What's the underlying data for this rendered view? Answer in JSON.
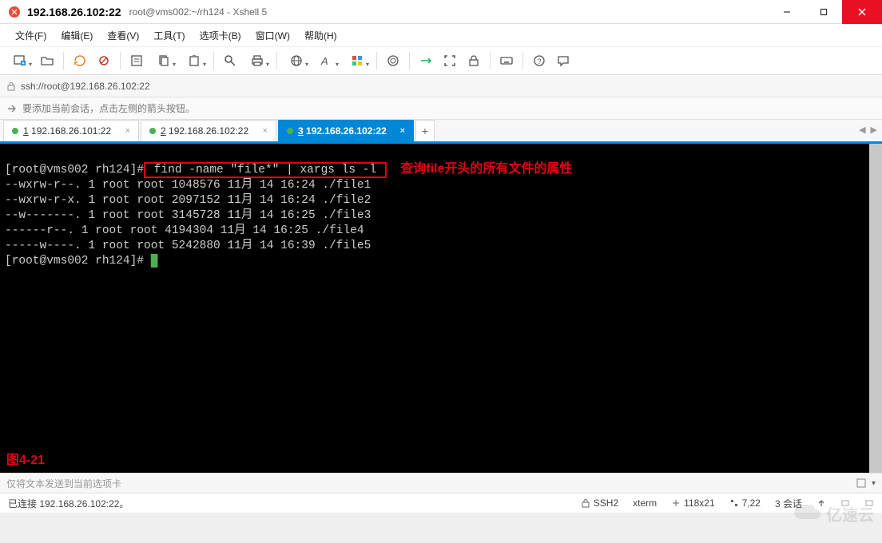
{
  "titlebar": {
    "host": "192.168.26.102:22",
    "subtitle": "root@vms002:~/rh124 - Xshell 5"
  },
  "menu": {
    "file": "文件(F)",
    "edit": "编辑(E)",
    "view": "查看(V)",
    "tools": "工具(T)",
    "tab": "选项卡(B)",
    "window": "窗口(W)",
    "help": "帮助(H)"
  },
  "addressbar": {
    "url": "ssh://root@192.168.26.102:22"
  },
  "hintbar": {
    "text": "要添加当前会话，点击左侧的箭头按钮。"
  },
  "tabs": [
    {
      "num": "1",
      "label": "192.168.26.101:22",
      "active": false
    },
    {
      "num": "2",
      "label": "192.168.26.102:22",
      "active": false
    },
    {
      "num": "3",
      "label": "192.168.26.102:22",
      "active": true
    }
  ],
  "terminal": {
    "prompt": "[root@vms002 rh124]#",
    "command": " find -name \"file*\" | xargs ls -l ",
    "annotation_right": "查询file开头的所有文件的属性",
    "lines": [
      "--wxrw-r--. 1 root root 1048576 11月 14 16:24 ./file1",
      "--wxrw-r-x. 1 root root 2097152 11月 14 16:24 ./file2",
      "--w-------. 1 root root 3145728 11月 14 16:25 ./file3",
      "------r--. 1 root root 4194304 11月 14 16:25 ./file4",
      "-----w----. 1 root root 5242880 11月 14 16:39 ./file5"
    ],
    "prompt2": "[root@vms002 rh124]# ",
    "figure_label": "图4-21"
  },
  "sendbar": {
    "placeholder": "仅将文本发送到当前选项卡"
  },
  "statusbar": {
    "conn": "已连接 192.168.26.102:22。",
    "proto": "SSH2",
    "term": "xterm",
    "size": "118x21",
    "pos": "7,22",
    "sessions": "3 会话"
  },
  "watermark": {
    "text": "亿速云"
  },
  "colors": {
    "accent": "#0087d8",
    "red": "#e60012",
    "green": "#4caf50"
  }
}
